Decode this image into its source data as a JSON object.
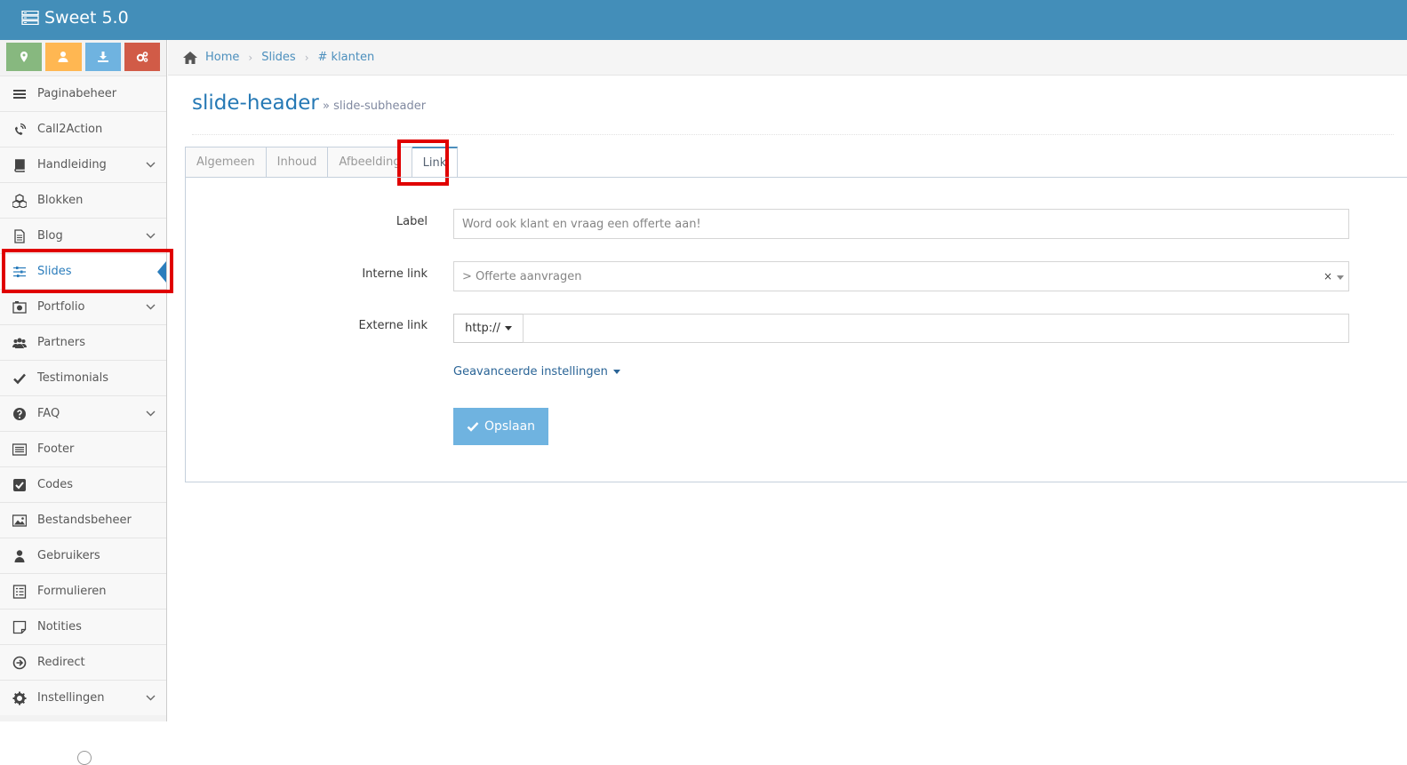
{
  "app": {
    "title": "Sweet 5.0"
  },
  "colors": {
    "navbar": "#438eb9",
    "shortcut_green": "#87b87f",
    "shortcut_orange": "#ffb752",
    "shortcut_blue": "#6fb3e0",
    "shortcut_red": "#d15b47",
    "accent": "#2b7dbc",
    "highlight": "#e00000"
  },
  "shortcuts": [
    {
      "icon": "map-marker-icon"
    },
    {
      "icon": "user-icon"
    },
    {
      "icon": "download-icon"
    },
    {
      "icon": "cogs-icon"
    }
  ],
  "sidebar": {
    "items": [
      {
        "label": "Paginabeheer",
        "icon": "bars-icon",
        "submenu": false
      },
      {
        "label": "Call2Action",
        "icon": "phone-volume-icon",
        "submenu": false
      },
      {
        "label": "Handleiding",
        "icon": "book-icon",
        "submenu": true
      },
      {
        "label": "Blokken",
        "icon": "cubes-icon",
        "submenu": false
      },
      {
        "label": "Blog",
        "icon": "file-text-icon",
        "submenu": true
      },
      {
        "label": "Slides",
        "icon": "sliders-icon",
        "submenu": false,
        "active": true
      },
      {
        "label": "Portfolio",
        "icon": "camera-icon",
        "submenu": true
      },
      {
        "label": "Partners",
        "icon": "users-icon",
        "submenu": false
      },
      {
        "label": "Testimonials",
        "icon": "check-icon",
        "submenu": false
      },
      {
        "label": "FAQ",
        "icon": "question-circle-icon",
        "submenu": true
      },
      {
        "label": "Footer",
        "icon": "list-alt-icon",
        "submenu": false
      },
      {
        "label": "Codes",
        "icon": "check-square-icon",
        "submenu": false
      },
      {
        "label": "Bestandsbeheer",
        "icon": "image-icon",
        "submenu": false
      },
      {
        "label": "Gebruikers",
        "icon": "user-icon",
        "submenu": false
      },
      {
        "label": "Formulieren",
        "icon": "list-form-icon",
        "submenu": false
      },
      {
        "label": "Notities",
        "icon": "sticky-note-icon",
        "submenu": false
      },
      {
        "label": "Redirect",
        "icon": "arrow-circle-right-icon",
        "submenu": false
      },
      {
        "label": "Instellingen",
        "icon": "cog-icon",
        "submenu": true
      }
    ]
  },
  "breadcrumbs": [
    {
      "label": "Home",
      "icon": "home-icon"
    },
    {
      "label": "Slides"
    },
    {
      "label": "# klanten"
    }
  ],
  "page_header": {
    "title": "slide-header",
    "separator": "»",
    "subtitle": "slide-subheader"
  },
  "tabs": [
    {
      "label": "Algemeen",
      "active": false
    },
    {
      "label": "Inhoud",
      "active": false
    },
    {
      "label": "Afbeelding",
      "active": false
    },
    {
      "label": "Link",
      "active": true
    }
  ],
  "form": {
    "label_field": {
      "label": "Label",
      "value": "Word ook klant en vraag een offerte aan!"
    },
    "internal_link": {
      "label": "Interne link",
      "value": "> Offerte aanvragen",
      "clear": "×"
    },
    "external_link": {
      "label": "Externe link",
      "protocol": "http://",
      "value": ""
    },
    "advanced": "Geavanceerde instellingen",
    "save": "Opslaan"
  }
}
